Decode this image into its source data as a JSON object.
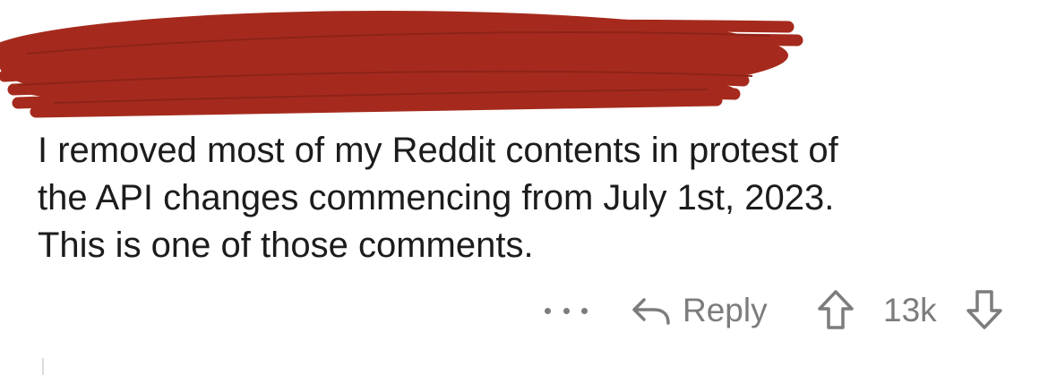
{
  "comment": {
    "body_lines": [
      "I removed most of my Reddit contents in protest of",
      "the API changes commencing from July 1st, 2023.",
      "This is one of those comments."
    ]
  },
  "actions": {
    "more_icon": "more-dots-icon",
    "reply_icon": "reply-arrow-icon",
    "reply_label": "Reply",
    "upvote_icon": "upvote-arrow-icon",
    "vote_count": "13k",
    "downvote_icon": "downvote-arrow-icon"
  },
  "colors": {
    "redaction": "#a52a1d",
    "text": "#1c1c1c",
    "muted": "#7c7c7c"
  }
}
